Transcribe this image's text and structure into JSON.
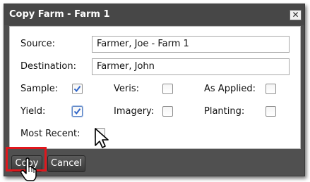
{
  "dialog": {
    "title": "Copy Farm - Farm 1",
    "close_glyph": "✕"
  },
  "form": {
    "source_label": "Source:",
    "source_value": "Farmer, Joe - Farm 1",
    "destination_label": "Destination:",
    "destination_value": "Farmer, John",
    "options": [
      {
        "label": "Sample:",
        "checked": true
      },
      {
        "label": "Veris:",
        "checked": false
      },
      {
        "label": "As Applied:",
        "checked": false
      },
      {
        "label": "Yield:",
        "checked": true
      },
      {
        "label": "Imagery:",
        "checked": false
      },
      {
        "label": "Planting:",
        "checked": false
      },
      {
        "label": "Most Recent:",
        "checked": false
      }
    ]
  },
  "footer": {
    "copy_label": "Copy",
    "cancel_label": "Cancel"
  },
  "cursors": [
    "arrow-cursor-icon",
    "hand-pointer-cursor-icon"
  ],
  "colors": {
    "titlebar": "#474747",
    "footer": "#505050",
    "check": "#2e64c8",
    "highlight": "#e0161c"
  }
}
